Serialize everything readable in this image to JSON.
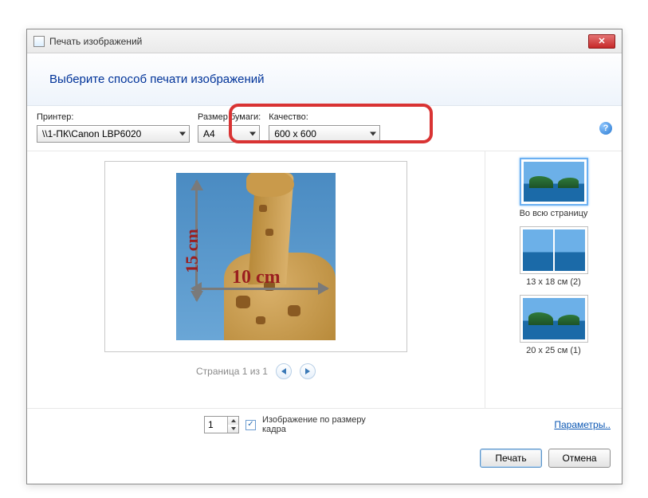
{
  "window": {
    "title": "Печать изображений"
  },
  "header": {
    "prompt": "Выберите способ печати изображений"
  },
  "options": {
    "printer_label": "Принтер:",
    "printer_value": "\\\\1-ПК\\Canon LBP6020",
    "paper_label": "Размер бумаги:",
    "paper_value": "A4",
    "quality_label": "Качество:",
    "quality_value": "600 x 600"
  },
  "help": {
    "glyph": "?"
  },
  "preview": {
    "dim_vertical": "15 cm",
    "dim_horizontal": "10 cm",
    "page_status": "Страница 1 из 1"
  },
  "layouts": [
    {
      "label": "Во всю страницу",
      "selected": true,
      "split": false
    },
    {
      "label": "13 x 18 см (2)",
      "selected": false,
      "split": true
    },
    {
      "label": "20 x 25 см (1)",
      "selected": false,
      "split": false
    }
  ],
  "footer": {
    "copies_value": "1",
    "fit_label": "Изображение по размеру кадра",
    "params_link": "Параметры.."
  },
  "actions": {
    "print": "Печать",
    "cancel": "Отмена"
  }
}
